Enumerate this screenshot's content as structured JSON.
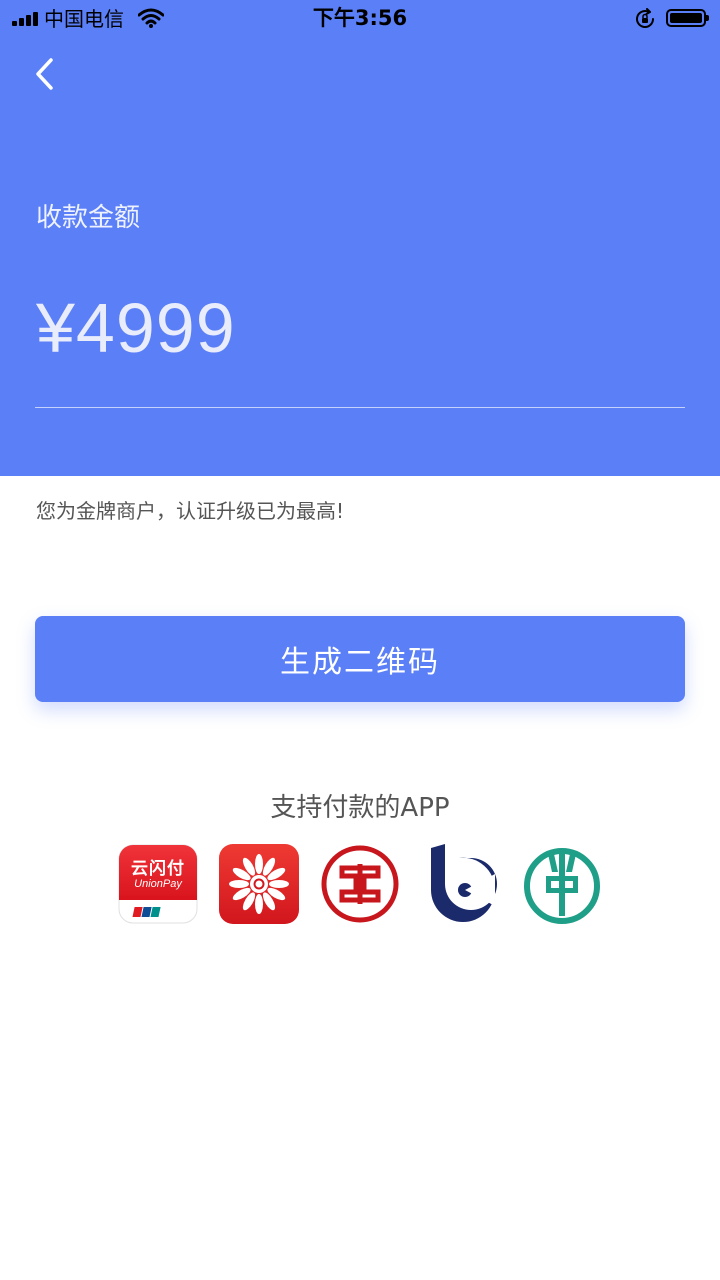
{
  "status_bar": {
    "carrier": "中国电信",
    "time": "下午3:56"
  },
  "header": {
    "amount_label": "收款金额",
    "amount_value": "¥4999"
  },
  "merchant_note": "您为金牌商户，认证升级已为最高!",
  "actions": {
    "generate_qr_label": "生成二维码"
  },
  "supported_apps": {
    "title": "支持付款的APP",
    "apps": [
      {
        "icon": "unionpay-cloud-icon",
        "name": "云闪付",
        "sub": "UnionPay"
      },
      {
        "icon": "flower-bank-icon"
      },
      {
        "icon": "icbc-icon"
      },
      {
        "icon": "bank-of-communications-icon"
      },
      {
        "icon": "agricultural-bank-icon"
      }
    ]
  },
  "colors": {
    "primary": "#5a7ff7",
    "text_secondary": "#555555",
    "icbc_red": "#c8161d",
    "bocom_navy": "#1b2a6b",
    "abc_green": "#1f9e88"
  }
}
